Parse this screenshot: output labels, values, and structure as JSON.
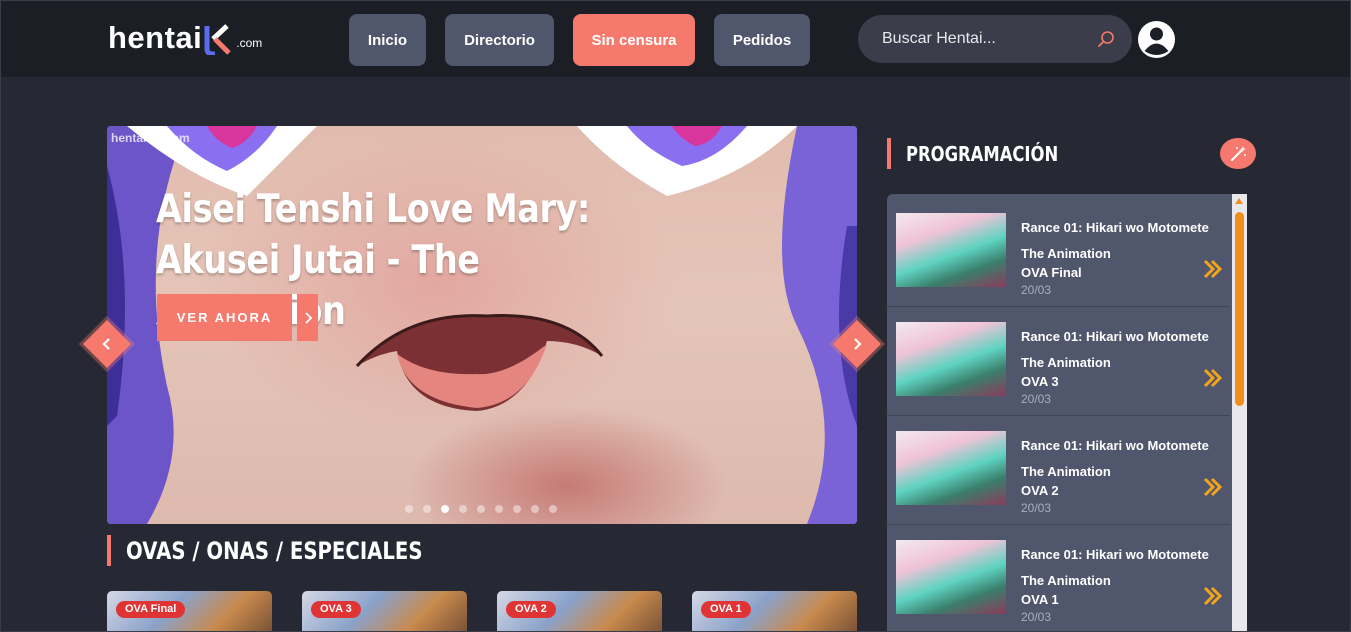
{
  "header": {
    "logo_text": "hentai",
    "logo_suffix": ".com",
    "nav": [
      {
        "label": "Inicio",
        "active": false
      },
      {
        "label": "Directorio",
        "active": false
      },
      {
        "label": "Sin censura",
        "active": true
      },
      {
        "label": "Pedidos",
        "active": false
      }
    ],
    "search_placeholder": "Buscar Hentai...",
    "icons": {
      "search": "search-icon",
      "user": "user-avatar-icon"
    }
  },
  "slider": {
    "watermark": "hentaiJK.com",
    "title": "Aisei Tenshi Love Mary: Akusei Jutai - The Animation",
    "cta_label": "VER AHORA",
    "dots_total": 9,
    "active_dot_index": 2,
    "icons": {
      "prev": "chevron-left-icon",
      "next": "chevron-right-icon"
    }
  },
  "ovas_section": {
    "title": "OVAS / ONAS / ESPECIALES",
    "cards": [
      {
        "badge": "OVA Final"
      },
      {
        "badge": "OVA 3"
      },
      {
        "badge": "OVA 2"
      },
      {
        "badge": "OVA 1"
      }
    ]
  },
  "schedule": {
    "title": "PROGRAMACIÓN",
    "button_icon": "magic-wand-icon",
    "items": [
      {
        "title": "Rance 01: Hikari wo Motomete The Animation",
        "episode": "OVA Final",
        "date": "20/03"
      },
      {
        "title": "Rance 01: Hikari wo Motomete The Animation",
        "episode": "OVA 3",
        "date": "20/03"
      },
      {
        "title": "Rance 01: Hikari wo Motomete The Animation",
        "episode": "OVA 2",
        "date": "20/03"
      },
      {
        "title": "Rance 01: Hikari wo Motomete The Animation",
        "episode": "OVA 1",
        "date": "20/03"
      }
    ]
  },
  "colors": {
    "accent": "#f57a6d",
    "header_bg": "#1c1e26",
    "page_bg": "#262934",
    "nav_btn": "#50566b",
    "badge_red": "#e03434",
    "go_arrow": "#f2a51c"
  }
}
